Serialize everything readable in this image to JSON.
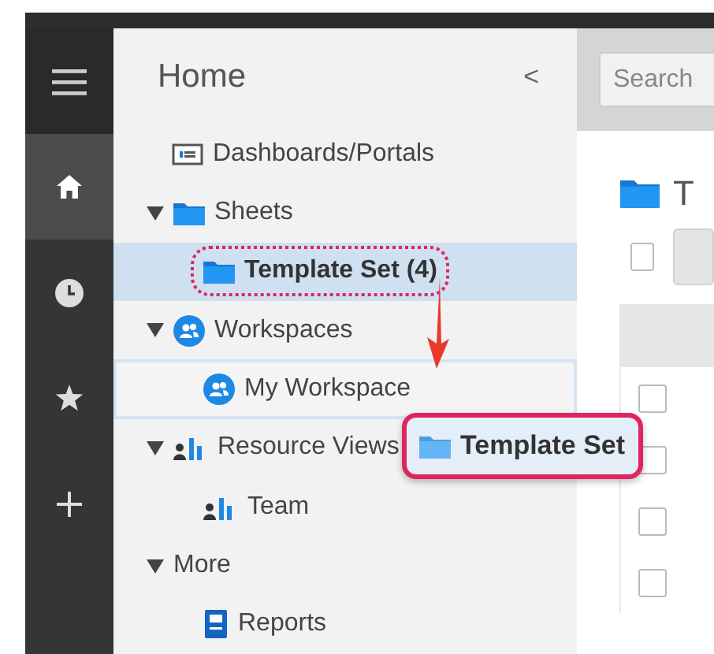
{
  "rail": [
    {
      "kind": "menu",
      "selected": false
    },
    {
      "kind": "home",
      "selected": true
    },
    {
      "kind": "recent",
      "selected": false
    },
    {
      "kind": "favorites",
      "selected": false
    },
    {
      "kind": "add",
      "selected": false
    }
  ],
  "sidebar": {
    "title": "Home",
    "collapse": "<",
    "tree": [
      {
        "label": "Dashboards/Portals",
        "kind": "dashboard",
        "selected": false
      },
      {
        "label": "Sheets",
        "kind": "folder",
        "expanded": true,
        "selected": false,
        "children": [
          {
            "label": "Template Set (4)",
            "kind": "folder",
            "selected": true,
            "highlighted": true
          }
        ]
      },
      {
        "label": "Workspaces",
        "kind": "workspace",
        "expanded": true,
        "selected": false,
        "children": [
          {
            "label": "My Workspace",
            "kind": "workspace",
            "selected": false,
            "drop_target": true
          }
        ]
      },
      {
        "label": "Resource Views",
        "kind": "resource",
        "expanded": true,
        "selected": false,
        "children": [
          {
            "label": "Team",
            "kind": "resource",
            "selected": false
          }
        ]
      },
      {
        "label": "More",
        "kind": "none",
        "expanded": true,
        "selected": false,
        "children": [
          {
            "label": "Reports",
            "kind": "report",
            "selected": false
          }
        ]
      }
    ]
  },
  "drag_ghost": {
    "label": "Template Set"
  },
  "content": {
    "search": {
      "placeholder": "Search"
    },
    "heading": "T",
    "rows": [
      {
        "checked": false
      },
      {
        "checked": false
      },
      {
        "checked": false
      },
      {
        "checked": false
      }
    ],
    "select_all": {
      "checked": false
    }
  }
}
